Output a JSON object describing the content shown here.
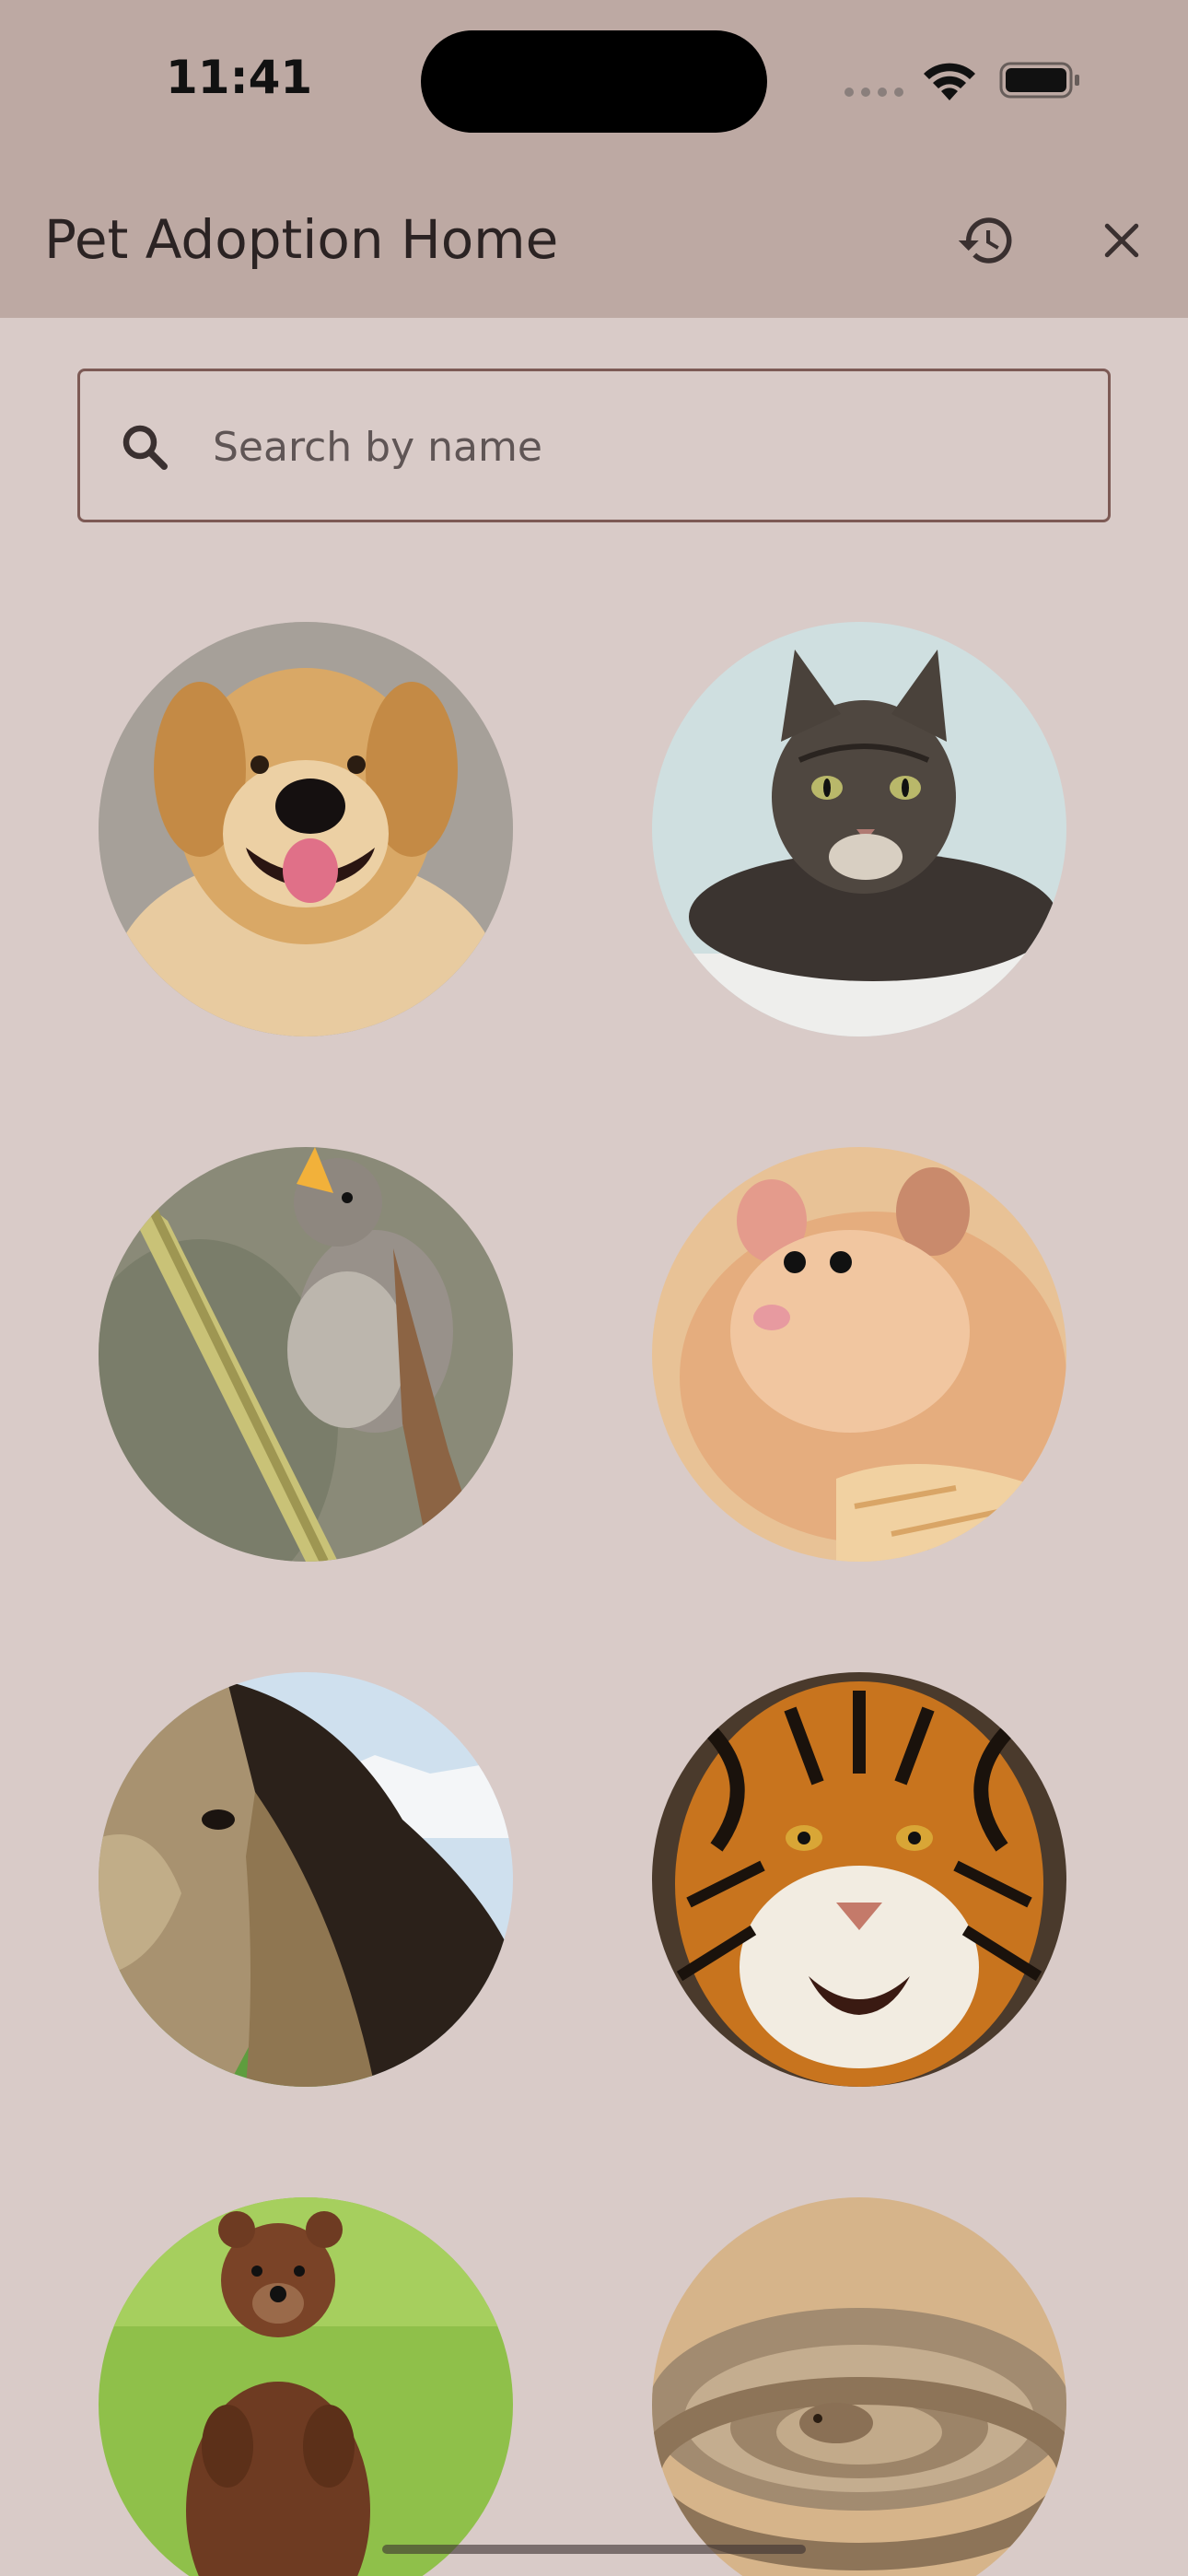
{
  "status_bar": {
    "time": "11:41"
  },
  "app_bar": {
    "title": "Pet Adoption Home",
    "history_icon": "history-icon",
    "close_icon": "close-icon"
  },
  "search": {
    "placeholder": "Search by name",
    "value": "",
    "icon": "search-icon"
  },
  "pets": [
    {
      "kind": "dog",
      "image": "golden-retriever-photo"
    },
    {
      "kind": "cat",
      "image": "tabby-cat-photo"
    },
    {
      "kind": "bird",
      "image": "nightingale-on-branch-photo"
    },
    {
      "kind": "hamster",
      "image": "hamster-photo"
    },
    {
      "kind": "horse",
      "image": "buckskin-horse-photo"
    },
    {
      "kind": "tiger",
      "image": "tiger-photo"
    },
    {
      "kind": "bear",
      "image": "brown-bear-cub-photo"
    },
    {
      "kind": "snake",
      "image": "rattlesnake-photo"
    }
  ],
  "colors": {
    "background": "#d9cbc8",
    "app_bar": "#bda9a3",
    "search_border": "#7d5a55",
    "title_text": "#2b2323"
  }
}
